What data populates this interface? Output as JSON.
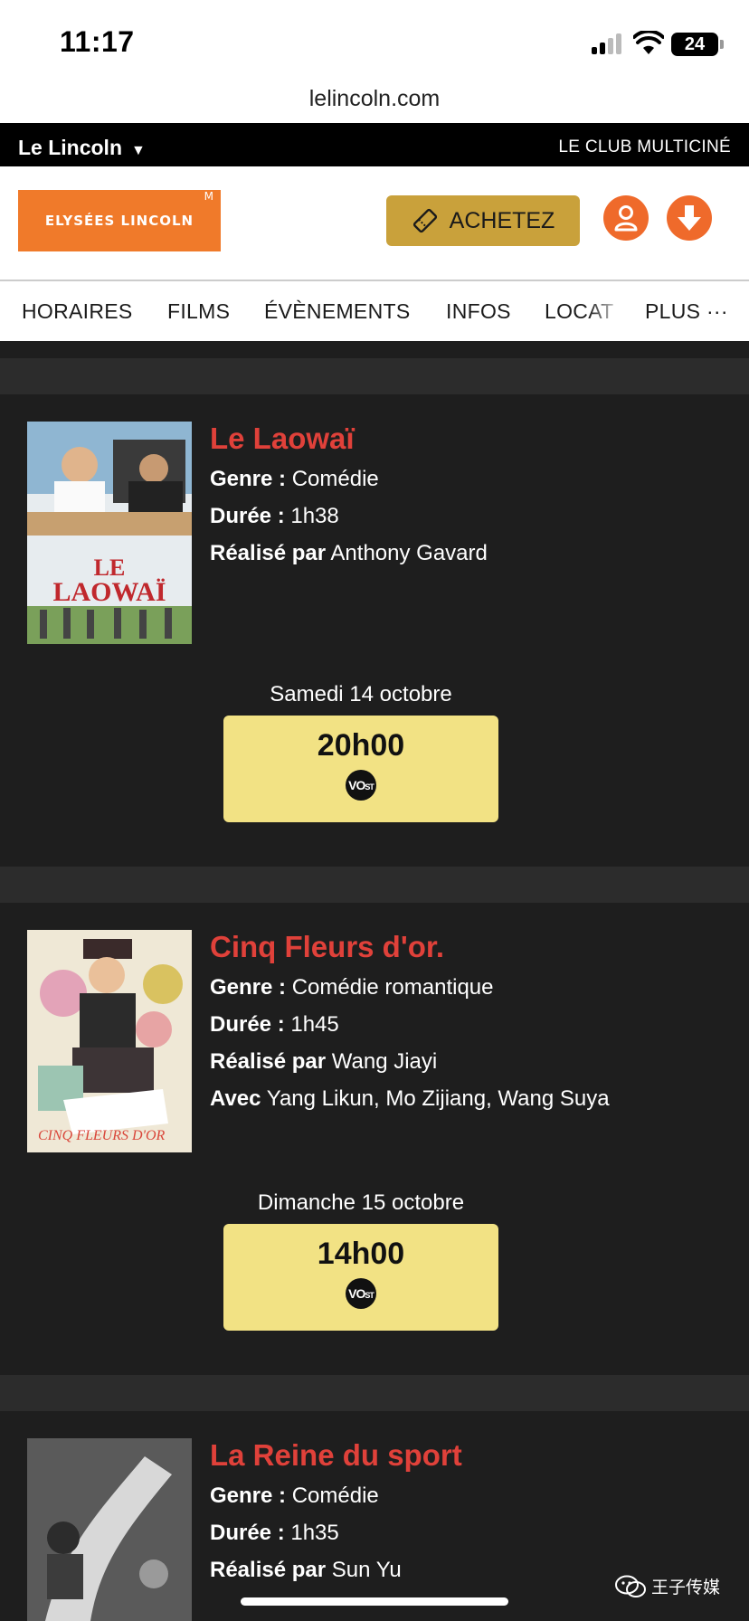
{
  "status": {
    "time": "11:17",
    "battery": "24"
  },
  "browser": {
    "url": "lelincoln.com"
  },
  "top_bar": {
    "cinema": "Le Lincoln",
    "club": "LE CLUB MULTICINÉ"
  },
  "header": {
    "logo_text": "ELYSÉES LINCOLN",
    "buy_label": "ACHETEZ"
  },
  "nav": {
    "items": [
      "HORAIRES",
      "FILMS",
      "ÉVÈNEMENTS",
      "INFOS",
      "LOCAT",
      "PLUS ···"
    ]
  },
  "labels": {
    "genre": "Genre :",
    "duree": "Durée :",
    "realise": "Réalisé par",
    "avec": "Avec"
  },
  "movies": [
    {
      "title": "Le Laowaï",
      "genre": "Comédie",
      "duree": "1h38",
      "realise": "Anthony Gavard",
      "date": "Samedi 14 octobre",
      "time": "20h00",
      "version": "VOST"
    },
    {
      "title": "Cinq Fleurs d'or.",
      "genre": "Comédie romantique",
      "duree": "1h45",
      "realise": "Wang Jiayi",
      "avec": "Yang Likun, Mo Zijiang, Wang Suya",
      "date": "Dimanche 15 octobre",
      "time": "14h00",
      "version": "VOST"
    },
    {
      "title": "La Reine du sport",
      "genre": "Comédie",
      "duree": "1h35",
      "realise": "Sun Yu"
    }
  ],
  "watermark": "王子传媒",
  "colors": {
    "accent_orange": "#ef6a2b",
    "buy_gold": "#c9a13b",
    "title_red": "#e0413a",
    "showtime_yellow": "#f2e284",
    "background": "#1e1e1e"
  }
}
